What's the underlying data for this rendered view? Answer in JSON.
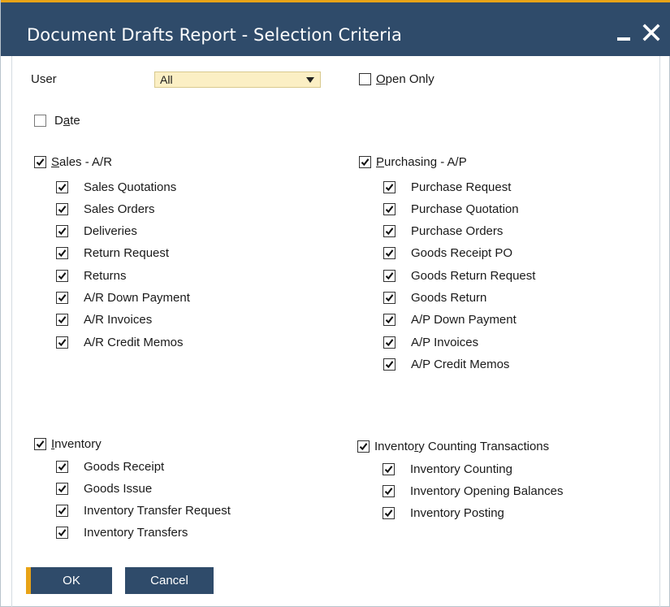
{
  "window": {
    "title": "Document Drafts Report - Selection Criteria",
    "accent_color": "#e8a317",
    "titlebar_color": "#2f4b6a",
    "minimize_icon": "minimize-icon",
    "close_icon": "close-icon"
  },
  "user": {
    "label": "User",
    "value": "All",
    "field_color": "#fbefc4"
  },
  "open_only": {
    "label": "Open Only",
    "checked": true
  },
  "date": {
    "label": "Date",
    "checked": false
  },
  "sales": {
    "label": "Sales - A/R",
    "checked": true,
    "items": [
      {
        "label": "Sales Quotations",
        "checked": true
      },
      {
        "label": "Sales Orders",
        "checked": true
      },
      {
        "label": "Deliveries",
        "checked": true
      },
      {
        "label": "Return Request",
        "checked": true
      },
      {
        "label": "Returns",
        "checked": true
      },
      {
        "label": "A/R Down Payment",
        "checked": true
      },
      {
        "label": "A/R Invoices",
        "checked": true
      },
      {
        "label": "A/R Credit Memos",
        "checked": true
      }
    ]
  },
  "purchasing": {
    "label": "Purchasing - A/P",
    "checked": true,
    "items": [
      {
        "label": "Purchase Request",
        "checked": true
      },
      {
        "label": "Purchase Quotation",
        "checked": true
      },
      {
        "label": "Purchase Orders",
        "checked": true
      },
      {
        "label": "Goods Receipt PO",
        "checked": true
      },
      {
        "label": "Goods Return Request",
        "checked": true
      },
      {
        "label": "Goods Return",
        "checked": true
      },
      {
        "label": "A/P Down Payment",
        "checked": true
      },
      {
        "label": "A/P Invoices",
        "checked": true
      },
      {
        "label": "A/P Credit Memos",
        "checked": true
      }
    ]
  },
  "inventory": {
    "label": "Inventory",
    "checked": true,
    "items": [
      {
        "label": "Goods Receipt",
        "checked": true
      },
      {
        "label": "Goods Issue",
        "checked": true
      },
      {
        "label": "Inventory Transfer Request",
        "checked": true
      },
      {
        "label": "Inventory Transfers",
        "checked": true
      }
    ]
  },
  "inventory_counting": {
    "label": "Inventory Counting Transactions",
    "checked": true,
    "items": [
      {
        "label": "Inventory Counting",
        "checked": true
      },
      {
        "label": "Inventory Opening Balances",
        "checked": true
      },
      {
        "label": "Inventory Posting",
        "checked": true
      }
    ]
  },
  "buttons": {
    "ok": "OK",
    "cancel": "Cancel"
  }
}
